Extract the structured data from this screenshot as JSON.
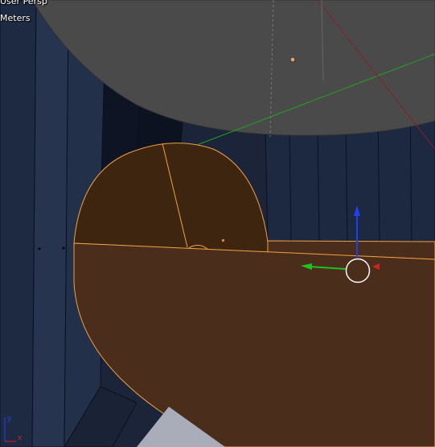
{
  "viewport": {
    "view_name": "User Persp",
    "units": "Meters",
    "axis_labels": {
      "x": "x",
      "y": "y"
    }
  },
  "colors": {
    "background": "#1b2438",
    "wall_dark": "#141c2e",
    "wall_panel": "#24314b",
    "ceiling_disc": "#4a4a4a",
    "selected_face": "#4a2d1a",
    "selected_edge": "#f0a040",
    "axis_x": "#d02020",
    "axis_y": "#20c020",
    "axis_z": "#2040f0",
    "floor_gray": "#a9adb9"
  },
  "icons": {
    "manipulator": "transform-manipulator-icon",
    "origin": "object-origin-icon",
    "axis_widget": "orientation-axes-icon"
  }
}
